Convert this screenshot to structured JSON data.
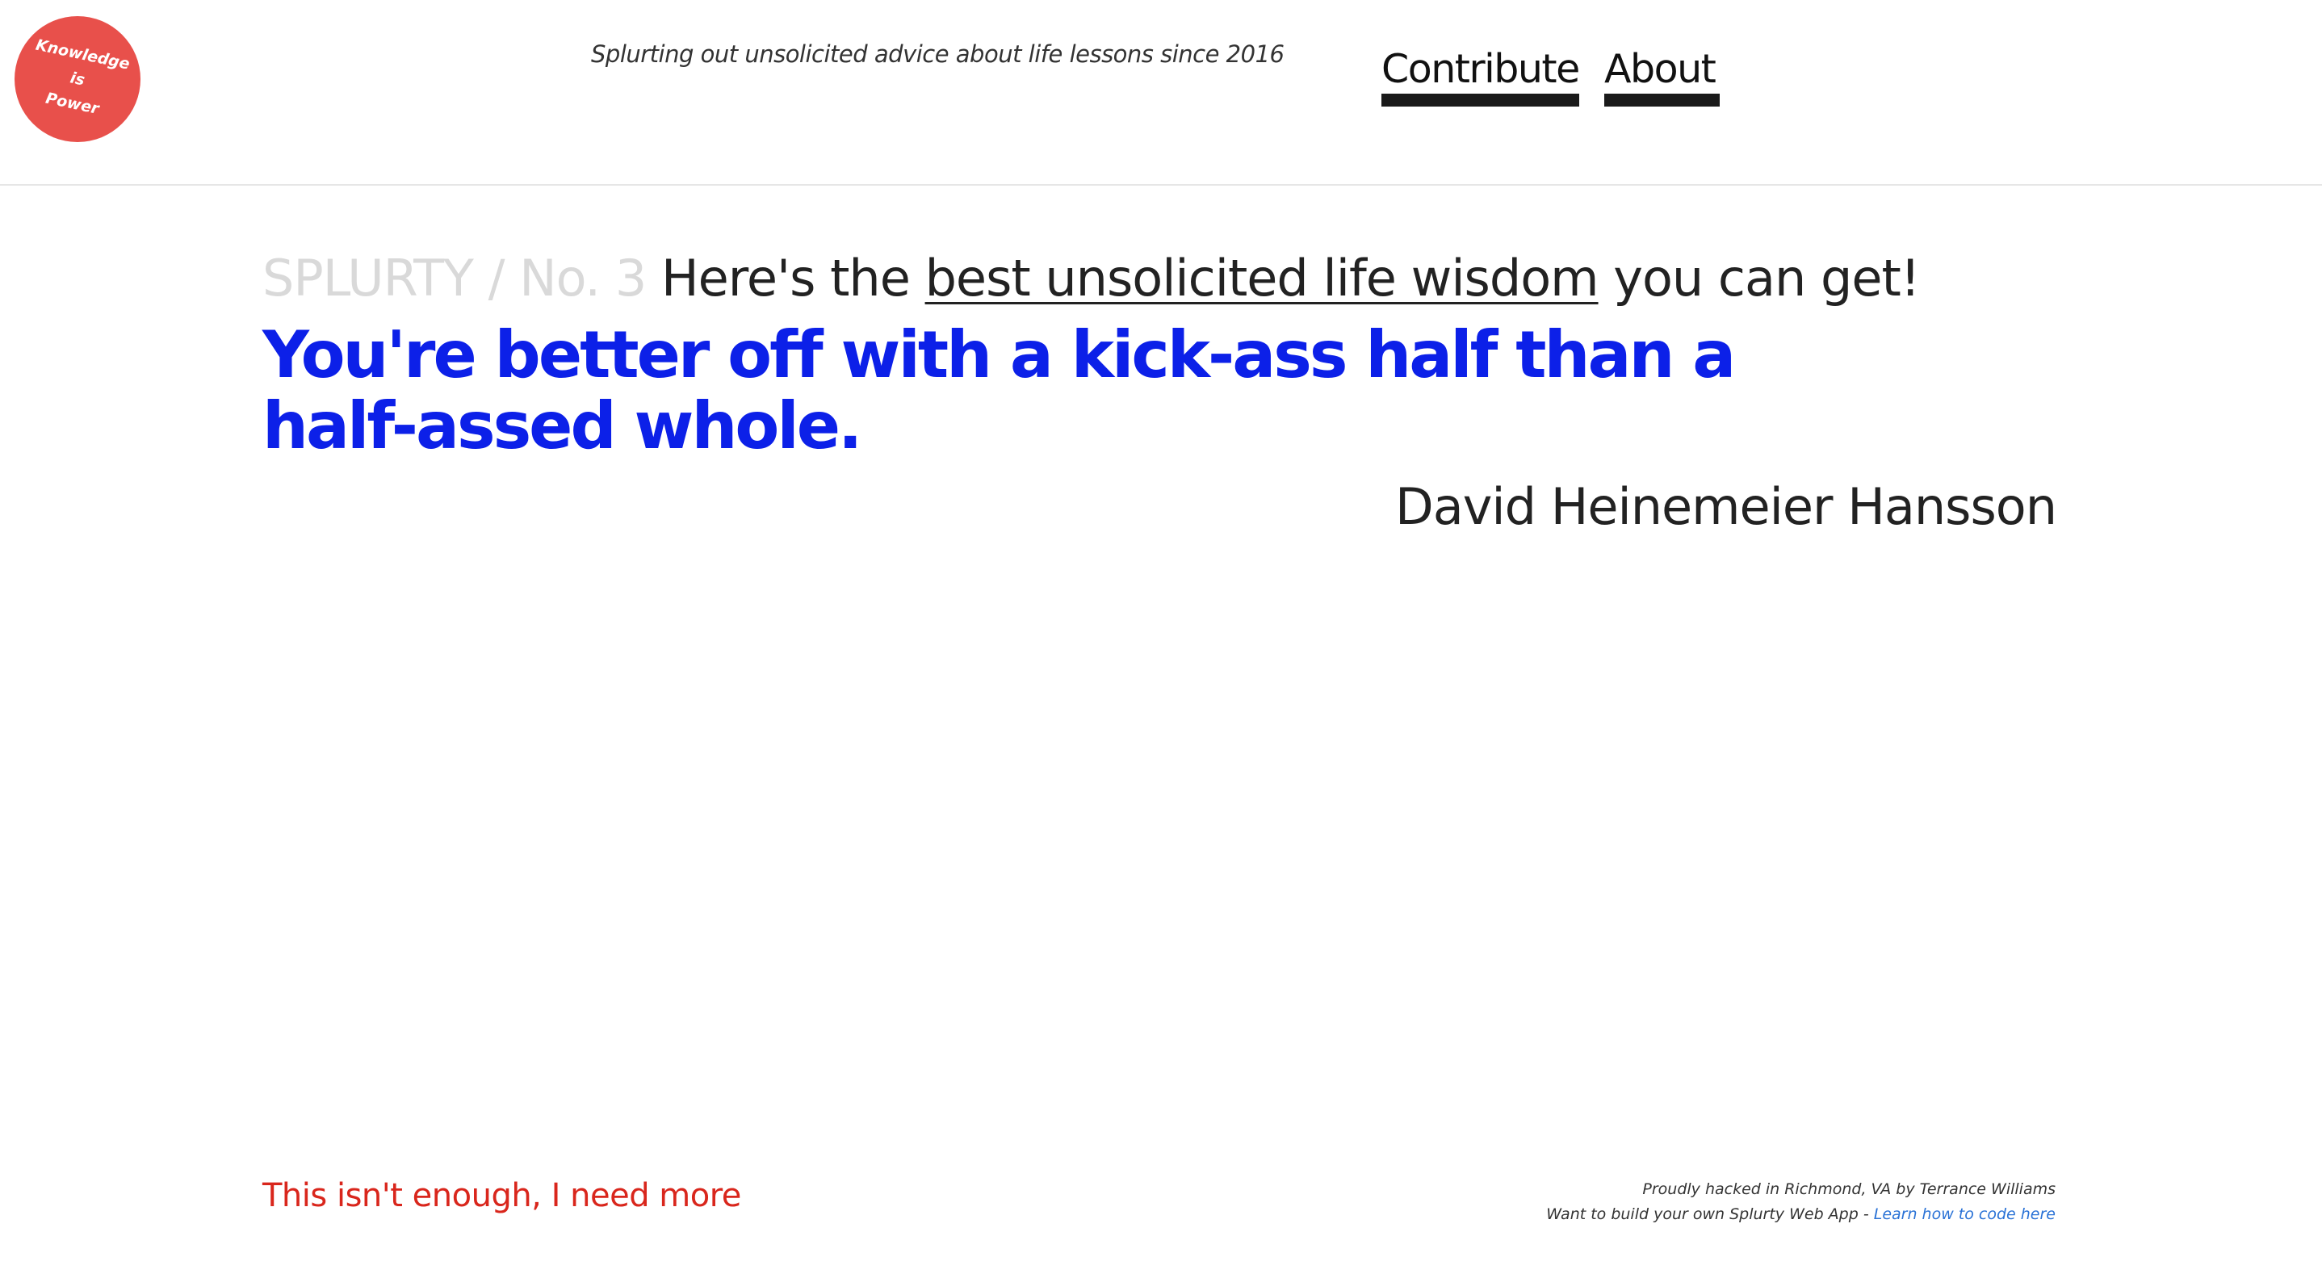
{
  "header": {
    "logo": {
      "line1": "Knowledge",
      "line2": "is",
      "line3": "Power",
      "color": "#e8504b"
    },
    "tagline": "Splurting out unsolicited advice about life lessons since 2016",
    "nav": {
      "contribute": "Contribute",
      "about": "About"
    }
  },
  "main": {
    "issue_label": "SPLURTY / No. 3",
    "intro_prefix": "Here's the",
    "intro_link": "best unsolicited life wisdom",
    "intro_suffix": "you can get!",
    "quote": "You're better off with a kick-ass half than a half-assed whole.",
    "author": "David Heinemeier Hansson",
    "quote_color": "#0c20e8"
  },
  "footer": {
    "more_link": "This isn't enough, I need more",
    "credit_line1": "Proudly hacked in Richmond, VA by Terrance Williams",
    "credit_line2_prefix": "Want to build your own Splurty Web App -",
    "credit_link": "Learn how to code here"
  }
}
